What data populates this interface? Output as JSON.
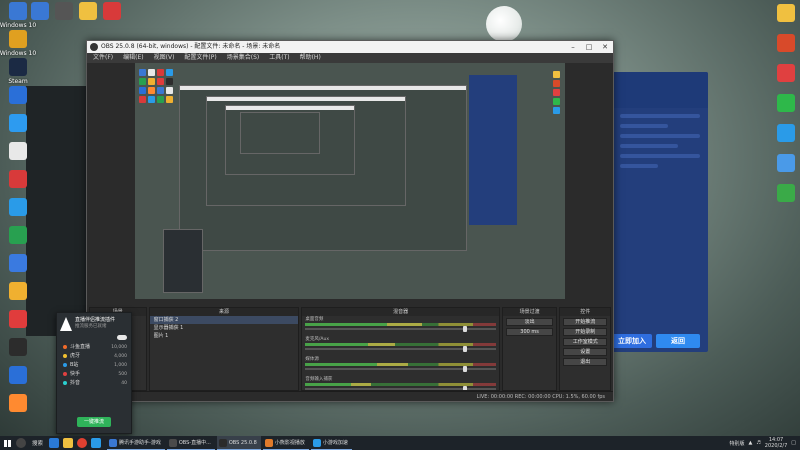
{
  "desktop_icons_left": [
    {
      "label": "Windows 10",
      "color": "#3a78d4"
    },
    {
      "label": "Windows 10",
      "color": "#e0a020"
    },
    {
      "label": "Steam",
      "color": "#1b2a44"
    },
    {
      "label": "",
      "color": "#2a6fd8"
    },
    {
      "label": "",
      "color": "#2d9bf0"
    },
    {
      "label": "",
      "color": "#e8e8e8"
    },
    {
      "label": "",
      "color": "#d83a3a"
    },
    {
      "label": "",
      "color": "#2a9be8"
    },
    {
      "label": "",
      "color": "#28a050"
    },
    {
      "label": "",
      "color": "#3a7ae0"
    },
    {
      "label": "",
      "color": "#f0b030"
    },
    {
      "label": "",
      "color": "#e03c3c"
    },
    {
      "label": "",
      "color": "#2c2c2c"
    },
    {
      "label": "",
      "color": "#2a6fd8"
    },
    {
      "label": "",
      "color": "#ff8a30"
    }
  ],
  "desktop_icons_top": [
    {
      "label": "",
      "color": "#3a78d4"
    },
    {
      "label": "",
      "color": "#555555"
    },
    {
      "label": "",
      "color": "#f0c040"
    },
    {
      "label": "",
      "color": "#d83a3a"
    }
  ],
  "desktop_icons_right": [
    {
      "label": "",
      "color": "#f0c040"
    },
    {
      "label": "",
      "color": "#d84a2a"
    },
    {
      "label": "",
      "color": "#e04040"
    },
    {
      "label": "",
      "color": "#2eb84a"
    },
    {
      "label": "",
      "color": "#2a9be8"
    },
    {
      "label": "",
      "color": "#4a9ae8"
    },
    {
      "label": "",
      "color": "#3aaa48"
    }
  ],
  "obs": {
    "title": "OBS 25.0.8 (64-bit, windows) - 配置文件: 未命名 - 场景: 未命名",
    "menu": [
      "文件(F)",
      "编辑(E)",
      "视图(V)",
      "配置文件(P)",
      "场景集合(S)",
      "工具(T)",
      "帮助(H)"
    ],
    "docks": {
      "scenes_title": "场景",
      "sources_title": "来源",
      "mixer_title": "混音器",
      "transitions_title": "场景过渡",
      "controls_title": "控件"
    },
    "sources": [
      "窗口捕获 2",
      "显示器捕获 1",
      "图片 1"
    ],
    "mixer": [
      {
        "name": "桌面音频",
        "level": 0.62,
        "volume": 0.86
      },
      {
        "name": "麦克风/Aux",
        "level": 0.48,
        "volume": 0.86
      },
      {
        "name": "媒体源",
        "level": 0.55,
        "volume": 0.86
      },
      {
        "name": "音频输入捕获",
        "level": 0.35,
        "volume": 0.86
      }
    ],
    "transition": {
      "value": "淡出",
      "duration": "300 ms"
    },
    "controls": [
      "开始推流",
      "开始录制",
      "工作室模式",
      "设置",
      "退出"
    ],
    "status": "LIVE: 00:00:00   REC: 00:00:00   CPU: 1.5%, 60.00 fps"
  },
  "popup": {
    "name": "直播伴侣推流插件",
    "subtitle": "推流服务已就绪",
    "items": [
      {
        "label": "斗鱼直播",
        "value": "10,000",
        "color": "#f06a2a"
      },
      {
        "label": "虎牙",
        "value": "4,000",
        "color": "#f0c030"
      },
      {
        "label": "B站",
        "value": "1,000",
        "color": "#2a9be8"
      },
      {
        "label": "快手",
        "value": "500",
        "color": "#e04040"
      },
      {
        "label": "抖音",
        "value": "40",
        "color": "#2ad0d0"
      }
    ],
    "button": "一键推流"
  },
  "right_app": {
    "join_label": "立即加入",
    "return_label": "返回"
  },
  "taskbar": {
    "search": "搜索",
    "tasks": [
      {
        "label": "腾讯手游助手-游戏",
        "color": "#3a78d4"
      },
      {
        "label": "OBS-直播中...",
        "color": "#4a4a4a"
      },
      {
        "label": "OBS 25.0.8",
        "color": "#2b2b2b"
      },
      {
        "label": "小熊影视播放",
        "color": "#e07a2a"
      },
      {
        "label": "小游戏加速",
        "color": "#2a9be8"
      }
    ],
    "tray_text": "特别版",
    "clock_time": "14:07",
    "clock_date": "2020/2/7"
  }
}
